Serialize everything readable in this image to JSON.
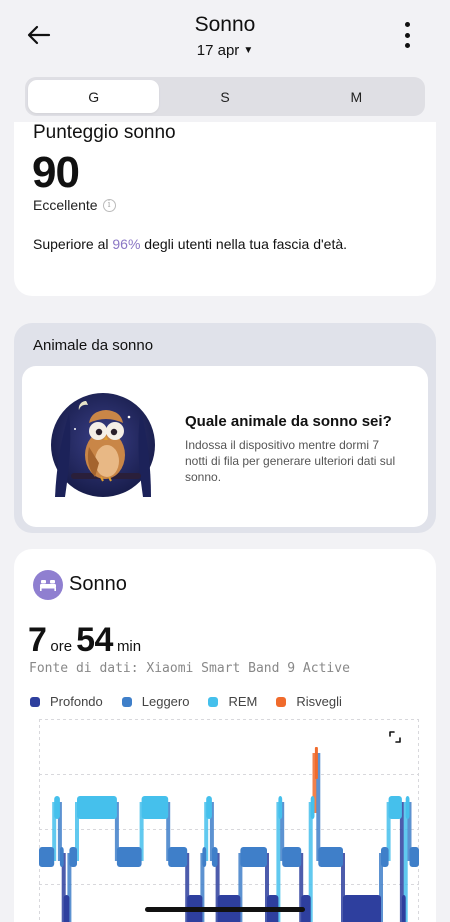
{
  "header": {
    "title": "Sonno",
    "date": "17 apr",
    "back_icon": "arrow-left-icon",
    "more_icon": "more-vertical-icon"
  },
  "tabs": [
    {
      "label": "G",
      "active": true
    },
    {
      "label": "S",
      "active": false
    },
    {
      "label": "M",
      "active": false
    }
  ],
  "score": {
    "title": "Punteggio sonno",
    "value": "90",
    "rating": "Eccellente",
    "compare_prefix": "Superiore al ",
    "compare_pct": "96%",
    "compare_suffix": " degli utenti nella tua fascia d'età.",
    "accent": "#8a76c4"
  },
  "animal": {
    "header": "Animale da sonno",
    "question": "Quale animale da sonno sei?",
    "description": "Indossa il dispositivo mentre dormi 7 notti di fila per generare ulteriori dati sul sonno.",
    "avatar_icon": "owl-avatar-icon"
  },
  "sleep": {
    "title": "Sonno",
    "icon": "bed-icon",
    "hours": "7",
    "hours_unit": "ore",
    "minutes": "54",
    "minutes_unit": "min",
    "source": "Fonte di dati: Xiaomi Smart Band 9 Active",
    "legend": [
      {
        "label": "Profondo",
        "color": "#2e3f9e"
      },
      {
        "label": "Leggero",
        "color": "#3f7fc9"
      },
      {
        "label": "REM",
        "color": "#45c0ec"
      },
      {
        "label": "Risvegli",
        "color": "#f06b2c"
      }
    ]
  },
  "chart_data": {
    "type": "area",
    "levels": [
      "Risvegli",
      "REM",
      "Leggero",
      "Profondo"
    ],
    "segments": [
      {
        "stage": "Leggero",
        "start": 0.0,
        "end": 0.04
      },
      {
        "stage": "REM",
        "start": 0.04,
        "end": 0.055
      },
      {
        "stage": "Leggero",
        "start": 0.055,
        "end": 0.065
      },
      {
        "stage": "Profondo",
        "start": 0.065,
        "end": 0.08
      },
      {
        "stage": "Leggero",
        "start": 0.08,
        "end": 0.1
      },
      {
        "stage": "REM",
        "start": 0.1,
        "end": 0.205
      },
      {
        "stage": "Leggero",
        "start": 0.205,
        "end": 0.27
      },
      {
        "stage": "REM",
        "start": 0.27,
        "end": 0.34
      },
      {
        "stage": "Leggero",
        "start": 0.34,
        "end": 0.39
      },
      {
        "stage": "Profondo",
        "start": 0.39,
        "end": 0.43
      },
      {
        "stage": "Leggero",
        "start": 0.43,
        "end": 0.44
      },
      {
        "stage": "REM",
        "start": 0.44,
        "end": 0.455
      },
      {
        "stage": "Leggero",
        "start": 0.455,
        "end": 0.47
      },
      {
        "stage": "Profondo",
        "start": 0.47,
        "end": 0.53
      },
      {
        "stage": "Leggero",
        "start": 0.53,
        "end": 0.6
      },
      {
        "stage": "Profondo",
        "start": 0.6,
        "end": 0.63
      },
      {
        "stage": "REM",
        "start": 0.63,
        "end": 0.64
      },
      {
        "stage": "Leggero",
        "start": 0.64,
        "end": 0.69
      },
      {
        "stage": "Profondo",
        "start": 0.69,
        "end": 0.715
      },
      {
        "stage": "REM",
        "start": 0.715,
        "end": 0.725
      },
      {
        "stage": "Risvegli",
        "start": 0.725,
        "end": 0.735
      },
      {
        "stage": "Leggero",
        "start": 0.735,
        "end": 0.8
      },
      {
        "stage": "Profondo",
        "start": 0.8,
        "end": 0.9
      },
      {
        "stage": "Leggero",
        "start": 0.9,
        "end": 0.92
      },
      {
        "stage": "REM",
        "start": 0.92,
        "end": 0.955
      },
      {
        "stage": "Profondo",
        "start": 0.955,
        "end": 0.965
      },
      {
        "stage": "REM",
        "start": 0.965,
        "end": 0.975
      },
      {
        "stage": "Leggero",
        "start": 0.975,
        "end": 1.0
      }
    ],
    "grid": true
  }
}
